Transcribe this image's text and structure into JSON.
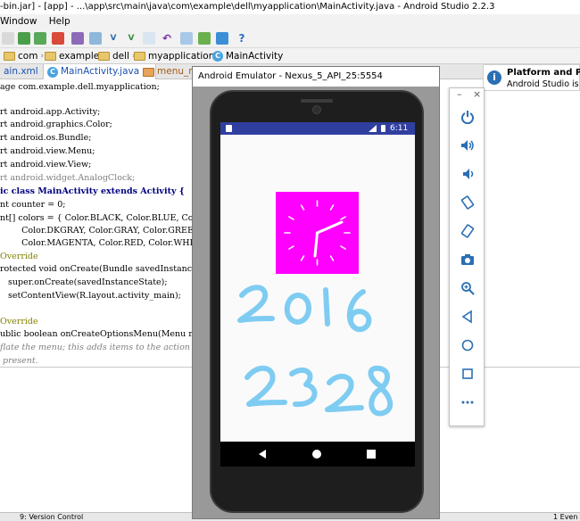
{
  "ide": {
    "title": "-bin.jar] - [app] - ...\\app\\src\\main\\java\\com\\example\\dell\\myapplication\\MainActivity.java - Android Studio 2.2.3",
    "menu": [
      "Window",
      "Help"
    ],
    "breadcrumbs": [
      "com",
      "example",
      "dell",
      "myapplication",
      "MainActivity"
    ],
    "tabs": [
      "ain.xml",
      "MainActivity.java",
      "menu_mai"
    ],
    "code": [
      "age com.example.dell.myapplication;",
      "",
      "rt android.app.Activity;",
      "rt android.graphics.Color;",
      "rt android.os.Bundle;",
      "rt android.view.Menu;",
      "rt android.view.View;",
      "rt android.widget.AnalogClock;",
      "ic class MainActivity extends Activity {",
      "nt counter = 0;",
      "nt[] colors = { Color.BLACK, Color.BLUE, Co",
      "        Color.DKGRAY, Color.GRAY, Color.GREEN",
      "        Color.MAGENTA, Color.RED, Color.WHITE",
      "Override",
      "rotected void onCreate(Bundle savedInstanceS",
      "   super.onCreate(savedInstanceState);",
      "   setContentView(R.layout.activity_main);",
      "",
      "Override",
      "ublic boolean onCreateOptionsMenu(Menu menu)",
      "flate the menu; this adds items to the action",
      " present."
    ],
    "status": "9: Version Control",
    "status_right": "1 Even"
  },
  "notification": {
    "title": "Platform and Plugin",
    "body": "Android Studio is read"
  },
  "emulator": {
    "title": "Android Emulator - Nexus_5_API_25:5554",
    "time": "6:11",
    "colors": {
      "status_bar": "#303f9f",
      "clock_bg": "#ff00ff",
      "scribble": "#7fccf2"
    },
    "tools": [
      "power-icon",
      "volume-up-icon",
      "volume-down-icon",
      "rotate-left-icon",
      "rotate-right-icon",
      "camera-icon",
      "zoom-icon",
      "back-icon",
      "home-icon",
      "overview-icon",
      "more-icon"
    ]
  }
}
